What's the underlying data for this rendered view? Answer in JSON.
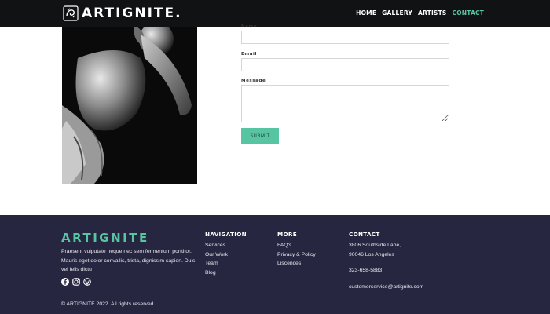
{
  "header": {
    "logo_text": "ARTIGNITE.",
    "nav": [
      {
        "label": "HOME",
        "active": false
      },
      {
        "label": "GALLERY",
        "active": false
      },
      {
        "label": "ARTISTS",
        "active": false
      },
      {
        "label": "CONTACT",
        "active": true
      }
    ]
  },
  "form": {
    "name_label": "Name",
    "email_label": "Email",
    "message_label": "Message",
    "submit_label": "SUBMIT",
    "name_value": "",
    "email_value": "",
    "message_value": ""
  },
  "footer": {
    "brand": "ARTIGNITE",
    "description": "Praesent vulputate neque nec sem fermentum porttitor. Mauris eget dolor convallis, trista, dignissim sapien. Duis vel felis dictu",
    "social_icons": [
      "facebook-icon",
      "instagram-icon",
      "wordpress-icon"
    ],
    "copyright": "© ARTIGNITE 2022. All rights reserved",
    "navigation": {
      "title": "NAVIGATION",
      "links": [
        "Services",
        "Our Work",
        "Team",
        "Blog"
      ]
    },
    "more": {
      "title": "MORE",
      "links": [
        "FAQ's",
        "Privacy & Policy",
        "Liscences"
      ]
    },
    "contact": {
      "title": "CONTACT",
      "address_line1": "3806 Southside Lane,",
      "address_line2": "90046 Los Angeles",
      "phone": "323-658-5883",
      "email": "customerservice@artignite.com"
    }
  },
  "colors": {
    "accent": "#57c4a2",
    "header_bg": "#111214",
    "footer_bg": "#272640"
  }
}
